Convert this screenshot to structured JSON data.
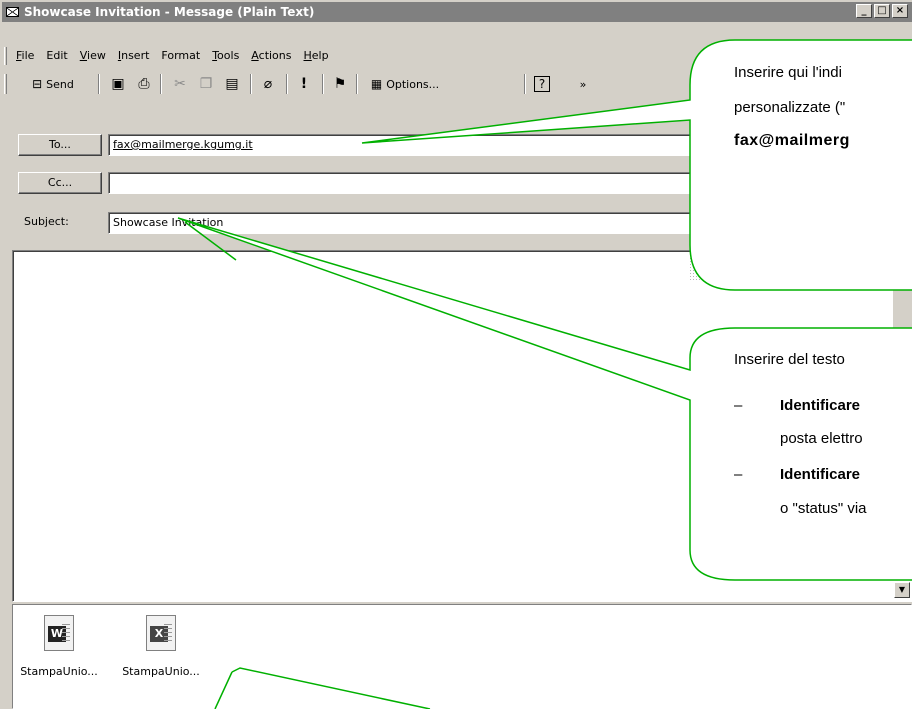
{
  "window": {
    "title": "Showcase Invitation - Message (Plain Text)",
    "controls": [
      "_",
      "□",
      "×"
    ]
  },
  "menu": {
    "items": [
      {
        "ul": "F",
        "rest": "ile"
      },
      {
        "ul": "",
        "rest": "Edit"
      },
      {
        "ul": "V",
        "rest": "iew"
      },
      {
        "ul": "I",
        "rest": "nsert"
      },
      {
        "ul": "",
        "rest": "Format"
      },
      {
        "ul": "T",
        "rest": "ools"
      },
      {
        "ul": "A",
        "rest": "ctions"
      },
      {
        "ul": "H",
        "rest": "elp"
      }
    ]
  },
  "toolbar": {
    "send_label": "Send",
    "options_label": "Options...",
    "overflow": "»"
  },
  "header": {
    "to_button": "To...",
    "to_value": "fax@mailmerge.kgumg.it",
    "cc_button": "Cc...",
    "cc_value": "",
    "subject_label": "Subject:",
    "subject_value": "Showcase Invitation"
  },
  "attachments": [
    {
      "name": "StampaUnio...",
      "kind": "word-document-icon",
      "badge": "W"
    },
    {
      "name": "StampaUnio...",
      "kind": "excel-spreadsheet-icon",
      "badge": "X"
    }
  ],
  "callouts": {
    "top": {
      "line1": "Inserire qui l'indi",
      "line2": "personalizzate (\"",
      "line3": "fax@mailmerg"
    },
    "middle": {
      "line1": "Inserire del testo",
      "bullet": "–",
      "item1a": "Identificare",
      "item1b": "posta elettro",
      "item2a": "Identificare",
      "item2b": "o \"status\" via"
    }
  },
  "colors": {
    "callout_stroke": "#00b000",
    "titlebar_inactive": "#808080",
    "chrome": "#d4d0c8"
  }
}
